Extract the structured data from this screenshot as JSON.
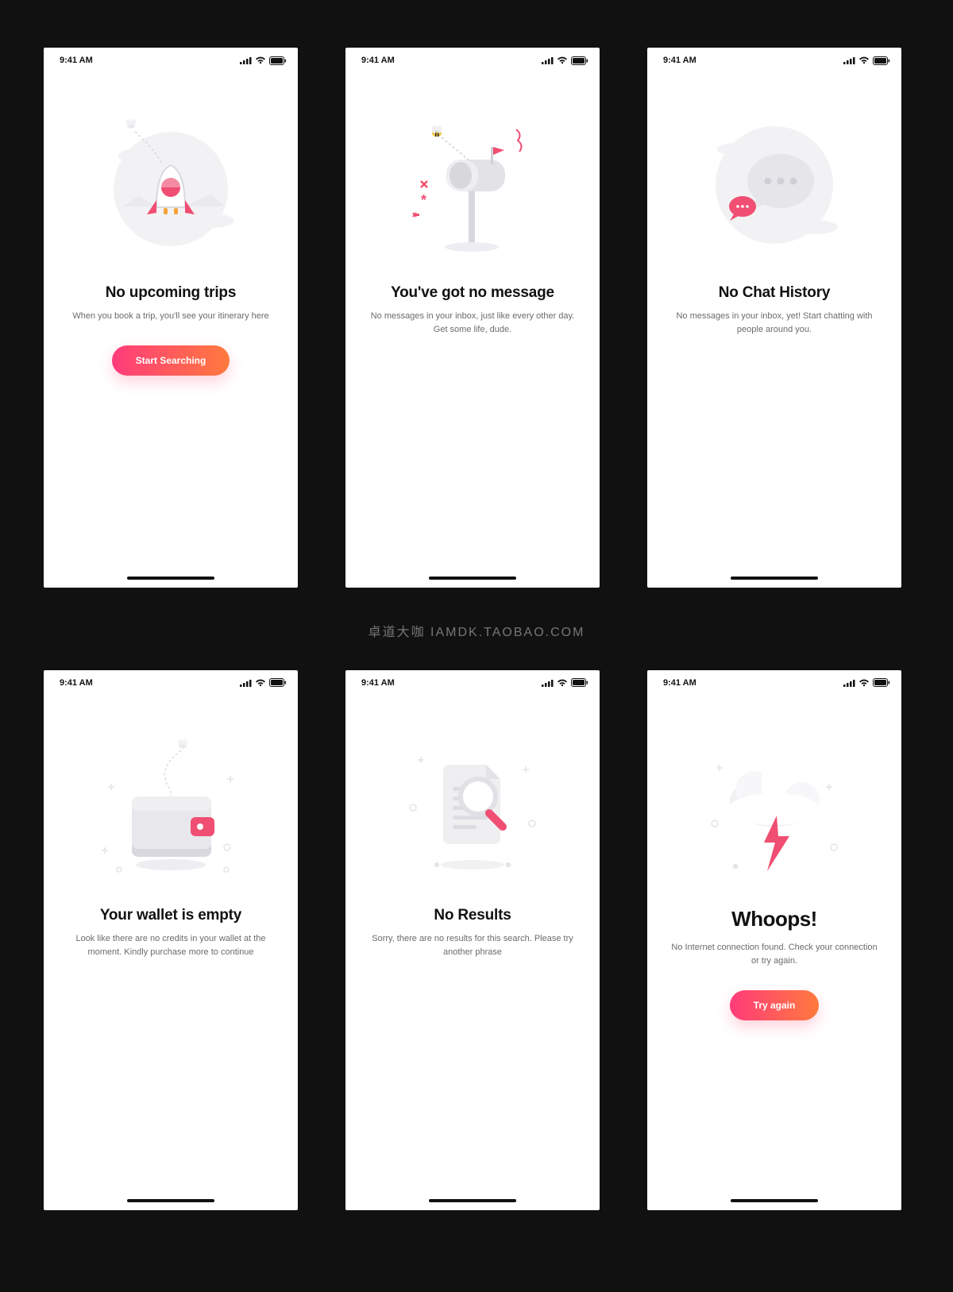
{
  "status_time": "9:41 AM",
  "watermark": "卓道大咖   IAMDK.TAOBAO.COM",
  "screens": [
    {
      "id": "trips",
      "title": "No upcoming trips",
      "subtitle": "When you book a trip, you'll see your itinerary here",
      "cta": "Start Searching",
      "icon": "rocket-illustration"
    },
    {
      "id": "inbox",
      "title": "You've got no message",
      "subtitle": "No messages in your inbox, just like every other day. Get some life, dude.",
      "cta": null,
      "icon": "mailbox-illustration"
    },
    {
      "id": "chat",
      "title": "No Chat History",
      "subtitle": "No messages in your inbox, yet! Start chatting with people around you.",
      "cta": null,
      "icon": "chat-bubble-illustration"
    },
    {
      "id": "wallet",
      "title": "Your wallet is empty",
      "subtitle": "Look like there are no credits in your wallet at the moment. Kindly purchase more to continue",
      "cta": null,
      "icon": "wallet-illustration"
    },
    {
      "id": "search",
      "title": "No Results",
      "subtitle": "Sorry, there are no results for this search. Please try another phrase",
      "cta": null,
      "icon": "search-document-illustration"
    },
    {
      "id": "offline",
      "title": "Whoops!",
      "subtitle": "No Internet connection found. Check your connection or try again.",
      "cta": "Try again",
      "icon": "storm-cloud-illustration",
      "large_title": true
    }
  ]
}
